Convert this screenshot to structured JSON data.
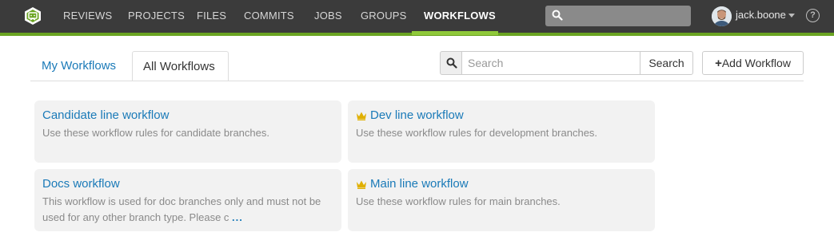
{
  "nav": {
    "items": [
      {
        "label": "REVIEWS"
      },
      {
        "label": "PROJECTS"
      },
      {
        "label": "FILES"
      },
      {
        "label": "COMMITS"
      },
      {
        "label": "JOBS"
      },
      {
        "label": "GROUPS"
      },
      {
        "label": "WORKFLOWS",
        "active": true
      }
    ],
    "search_placeholder": "",
    "username": "jack.boone",
    "help_label": "?"
  },
  "tabs": [
    {
      "label": "My Workflows",
      "active": false
    },
    {
      "label": "All Workflows",
      "active": true
    }
  ],
  "search": {
    "placeholder": "Search",
    "button_label": "Search"
  },
  "add_button": {
    "label": "Add Workflow"
  },
  "workflows": [
    {
      "title": "Candidate line workflow",
      "description": "Use these workflow rules for candidate branches.",
      "crown": false
    },
    {
      "title": "Dev line workflow",
      "description": "Use these workflow rules for development branches.",
      "crown": true
    },
    {
      "title": "Docs workflow",
      "description": "This workflow is used for doc branches only and must not be used for any other branch type. Please c",
      "more": "...",
      "crown": false
    },
    {
      "title": "Main line workflow",
      "description": "Use these workflow rules for main branches.",
      "crown": true
    }
  ],
  "colors": {
    "accent": "#6aa421",
    "link": "#1a7ab8",
    "crown": "#e0b000",
    "topbar": "#3b3b3b"
  }
}
